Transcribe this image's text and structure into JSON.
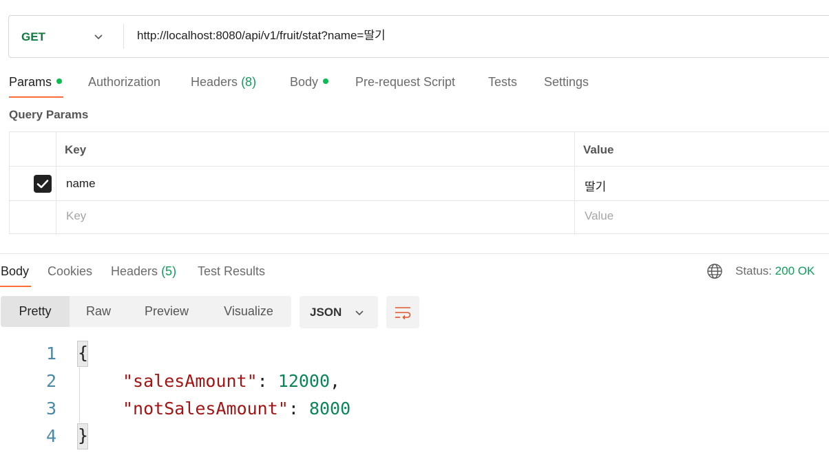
{
  "request": {
    "method": "GET",
    "url": "http://localhost:8080/api/v1/fruit/stat?name=딸기"
  },
  "request_tabs": [
    {
      "label": "Params",
      "dot": true
    },
    {
      "label": "Authorization"
    },
    {
      "label": "Headers",
      "count": "(8)"
    },
    {
      "label": "Body",
      "dot": true
    },
    {
      "label": "Pre-request Script"
    },
    {
      "label": "Tests"
    },
    {
      "label": "Settings"
    }
  ],
  "query_params": {
    "title": "Query Params",
    "headers": {
      "key": "Key",
      "value": "Value"
    },
    "rows": [
      {
        "checked": true,
        "key": "name",
        "value": "딸기"
      }
    ],
    "placeholder": {
      "key": "Key",
      "value": "Value"
    }
  },
  "response_tabs": [
    {
      "label": "Body"
    },
    {
      "label": "Cookies"
    },
    {
      "label": "Headers",
      "count": "(5)"
    },
    {
      "label": "Test Results"
    }
  ],
  "status": {
    "label": "Status:",
    "value": "200 OK"
  },
  "view_modes": [
    "Pretty",
    "Raw",
    "Preview",
    "Visualize"
  ],
  "format": "JSON",
  "icons": {
    "method_chevron": "chevron-down-icon",
    "checkbox": "check-icon",
    "globe": "globe-icon",
    "format_chevron": "chevron-down-icon",
    "wrap": "wrap-lines-icon"
  },
  "code": {
    "line_numbers": [
      "1",
      "2",
      "3",
      "4"
    ],
    "open_brace": "{",
    "close_brace": "}",
    "lines": [
      {
        "key": "\"salesAmount\"",
        "sep": ": ",
        "value": "12000",
        "trail": ","
      },
      {
        "key": "\"notSalesAmount\"",
        "sep": ": ",
        "value": "8000",
        "trail": ""
      }
    ]
  },
  "colors": {
    "accent": "#ff6c37",
    "method": "#0f7a3d",
    "success": "#0f9d58",
    "dot": "#0cbb52"
  }
}
